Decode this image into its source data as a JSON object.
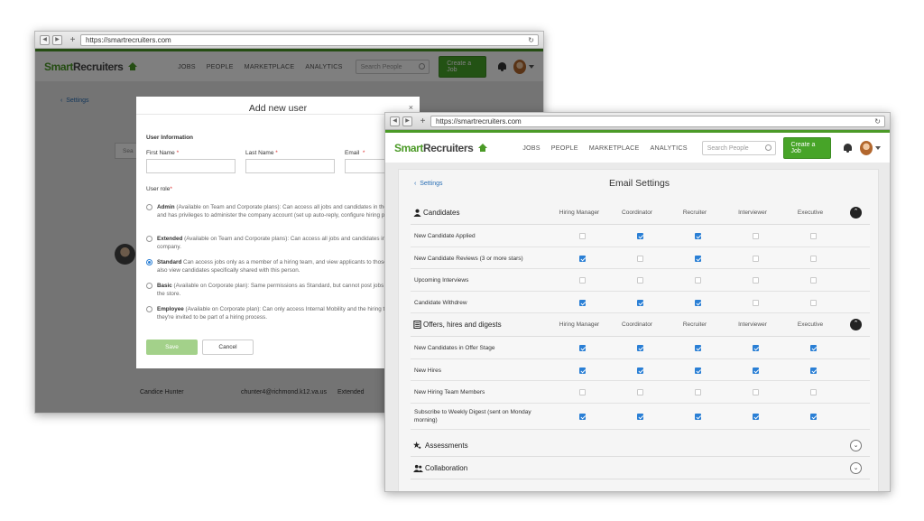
{
  "url": "https://smartrecruiters.com",
  "app": {
    "logo_part1": "Smart",
    "logo_part2": "Recruiters",
    "nav": [
      "JOBS",
      "PEOPLE",
      "MARKETPLACE",
      "ANALYTICS"
    ],
    "search_placeholder": "Search People",
    "create_job": "Create a Job"
  },
  "modal": {
    "title": "Add new user",
    "close": "×",
    "section": "User Information",
    "first_name": "First Name",
    "last_name": "Last Name",
    "email": "Email",
    "required": "*",
    "user_role": "User role",
    "roles": [
      {
        "name": "Admin",
        "desc": " (Available on Team and Corporate plans): Can access all jobs and candidates in the company, and has privileges to administer the company account (set up auto-reply, configure hiring process etc).",
        "selected": false
      },
      {
        "name": "Extended",
        "desc": " (Available on Team and Corporate plans): Can access all jobs and candidates in the company.",
        "selected": false
      },
      {
        "name": "Standard",
        "desc": " Can access jobs only as a member of a hiring team, and view applicants to those jobs. Can also view candidates specifically shared with this person.",
        "selected": true
      },
      {
        "name": "Basic",
        "desc": " (Available on Corporate plan): Same permissions as Standard, but cannot post jobs for money in the store.",
        "selected": false
      },
      {
        "name": "Employee",
        "desc": " (Available on Corporate plan): Can only access Internal Mobility and the hiring team unless they're invited to be part of a hiring process.",
        "selected": false
      }
    ],
    "save": "Save",
    "cancel": "Cancel"
  },
  "background": {
    "back": "Settings",
    "search": "Sea",
    "user_row": {
      "name": "Candice Hunter",
      "email": "chunter4@richmond.k12.va.us",
      "role": "Extended"
    }
  },
  "settings": {
    "back": "Settings",
    "title": "Email Settings",
    "columns": [
      "Hiring Manager",
      "Coordinator",
      "Recruiter",
      "Interviewer",
      "Executive"
    ],
    "sections": [
      {
        "name": "Candidates",
        "icon": "person-icon",
        "expanded": true,
        "rows": [
          {
            "label": "New Candidate Applied",
            "checks": [
              false,
              true,
              true,
              false,
              false
            ]
          },
          {
            "label": "New Candidate Reviews (3 or more stars)",
            "checks": [
              true,
              false,
              true,
              false,
              false
            ]
          },
          {
            "label": "Upcoming Interviews",
            "checks": [
              false,
              false,
              false,
              false,
              false
            ]
          },
          {
            "label": "Candidate Withdrew",
            "checks": [
              true,
              true,
              true,
              false,
              false
            ]
          }
        ]
      },
      {
        "name": "Offers, hires and digests",
        "icon": "document-icon",
        "expanded": true,
        "rows": [
          {
            "label": "New Candidates in Offer Stage",
            "checks": [
              true,
              true,
              true,
              true,
              true
            ]
          },
          {
            "label": "New Hires",
            "checks": [
              true,
              true,
              true,
              true,
              true
            ]
          },
          {
            "label": "New Hiring Team Members",
            "checks": [
              false,
              false,
              false,
              false,
              false
            ]
          },
          {
            "label": "Subscribe to Weekly Digest (sent on Monday morning)",
            "checks": [
              true,
              true,
              true,
              true,
              true
            ]
          }
        ]
      }
    ],
    "collapsed": [
      {
        "name": "Assessments",
        "icon": "star-person-icon"
      },
      {
        "name": "Collaboration",
        "icon": "group-icon"
      }
    ],
    "toggle_up": "⌃",
    "toggle_down": "⌄"
  }
}
